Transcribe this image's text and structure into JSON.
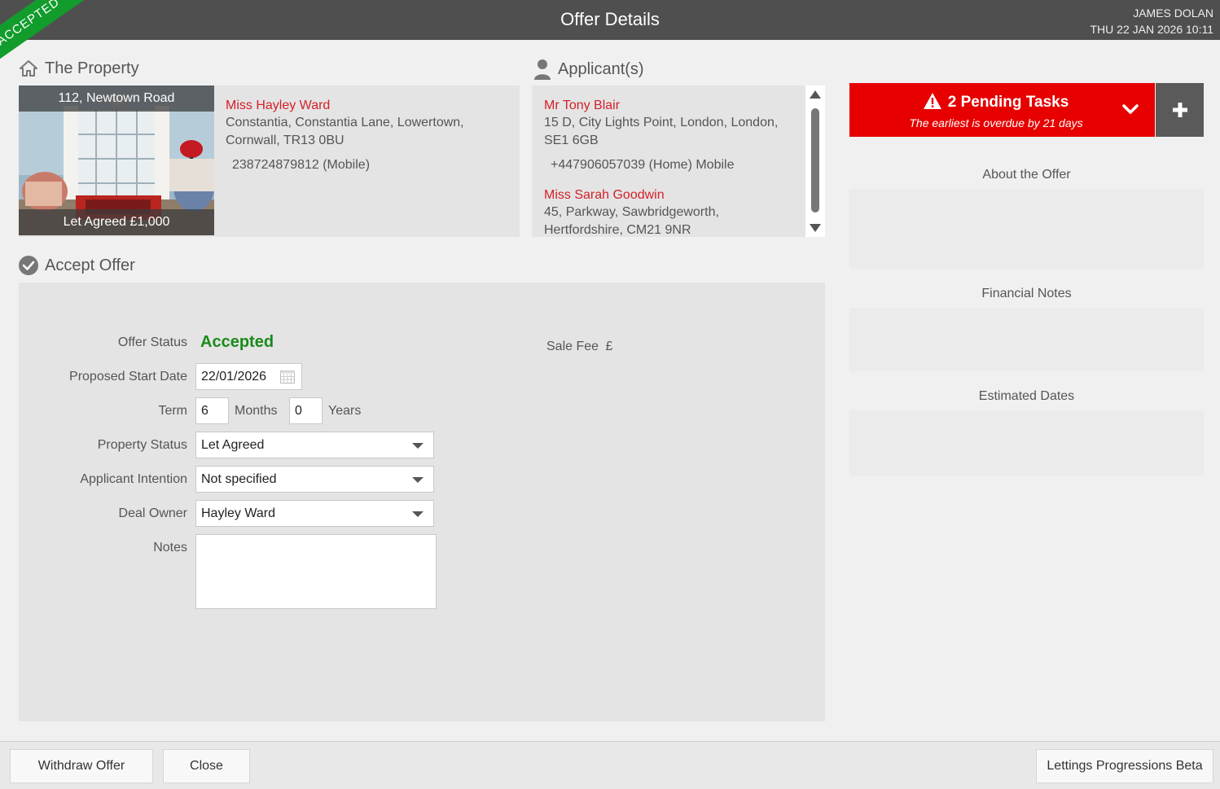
{
  "header": {
    "title": "Offer Details",
    "user_name": "JAMES DOLAN",
    "datetime": "THU 22 JAN 2026 10:11",
    "ribbon": "ACCEPTED"
  },
  "property": {
    "section_title": "The Property",
    "address_caption": "112, Newtown Road",
    "status_caption": "Let Agreed £1,000",
    "owner_name": "Miss Hayley Ward",
    "owner_address_line1": "Constantia, Constantia Lane, Lowertown,",
    "owner_address_line2": "Cornwall, TR13 0BU",
    "owner_phone": "238724879812 (Mobile)"
  },
  "applicants": {
    "section_title": "Applicant(s)",
    "items": [
      {
        "name": "Mr Tony Blair",
        "address_line1": "15 D, City Lights Point, London, London,",
        "address_line2": "SE1 6GB",
        "phone": "+447906057039 (Home) Mobile"
      },
      {
        "name": "Miss Sarah Goodwin",
        "address_line1": "45, Parkway, Sawbridgeworth,",
        "address_line2": "Hertfordshire, CM21 9NR"
      }
    ]
  },
  "accept_offer": {
    "section_title": "Accept Offer",
    "offer_status_label": "Offer Status",
    "offer_status_value": "Accepted",
    "start_date_label": "Proposed Start Date",
    "start_date_value": "22/01/2026",
    "term_label": "Term",
    "term_months_value": "6",
    "months_label": "Months",
    "term_years_value": "0",
    "years_label": "Years",
    "property_status_label": "Property Status",
    "property_status_value": "Let Agreed",
    "applicant_intention_label": "Applicant Intention",
    "applicant_intention_value": "Not specified",
    "deal_owner_label": "Deal Owner",
    "deal_owner_value": "Hayley Ward",
    "notes_label": "Notes",
    "notes_value": "",
    "sale_fee_label": "Sale Fee",
    "sale_fee_currency": "£"
  },
  "tasks": {
    "title": "2 Pending Tasks",
    "subtitle": "The earliest is overdue by 21 days"
  },
  "right_panel": {
    "about_title": "About the Offer",
    "financial_title": "Financial Notes",
    "estimated_title": "Estimated Dates"
  },
  "footer": {
    "withdraw_label": "Withdraw Offer",
    "close_label": "Close",
    "progressions_label": "Lettings Progressions Beta"
  },
  "colors": {
    "accent_red": "#e60000",
    "name_red": "#d4202a",
    "accepted_green": "#1a8a1a",
    "ribbon_green": "#119c2c",
    "header_bg": "#4f4f4f"
  }
}
